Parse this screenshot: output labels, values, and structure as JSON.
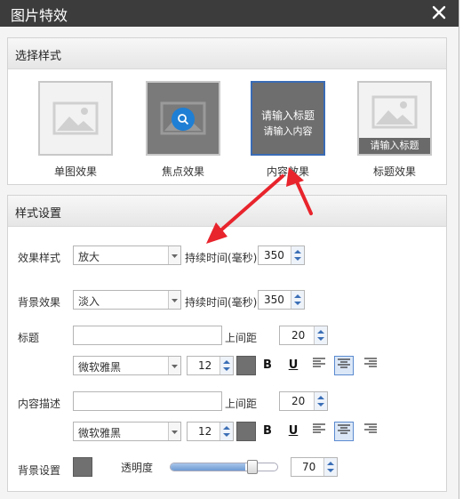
{
  "dialog": {
    "title": "图片特效"
  },
  "style_select": {
    "heading": "选择样式",
    "items": [
      {
        "label": "单图效果"
      },
      {
        "label": "焦点效果"
      },
      {
        "label": "内容效果",
        "overlay_title": "请输入标题",
        "overlay_content": "请输入内容"
      },
      {
        "label": "标题效果",
        "overlay_title": "请输入标题"
      }
    ]
  },
  "style_settings": {
    "heading": "样式设置",
    "effect_style": {
      "label": "效果样式",
      "value": "放大",
      "duration_label": "持续时间(毫秒)",
      "duration": "350"
    },
    "bg_effect": {
      "label": "背景效果",
      "value": "淡入",
      "duration_label": "持续时间(毫秒)",
      "duration": "350"
    },
    "title": {
      "label": "标题",
      "value": "",
      "spacing_label": "上间距",
      "spacing": "20",
      "font": "微软雅黑",
      "size": "12"
    },
    "content": {
      "label": "内容描述",
      "value": "",
      "spacing_label": "上间距",
      "spacing": "20",
      "font": "微软雅黑",
      "size": "12"
    },
    "format": {
      "bold": "B",
      "underline": "U"
    },
    "background": {
      "label": "背景设置",
      "opacity_label": "透明度",
      "opacity": "70",
      "opacity_fraction": 0.7
    }
  },
  "colors": {
    "accent": "#3a6bb5",
    "titlebar": "#3c3c3c",
    "swatch": "#707070",
    "arrow": "#e8242c"
  }
}
